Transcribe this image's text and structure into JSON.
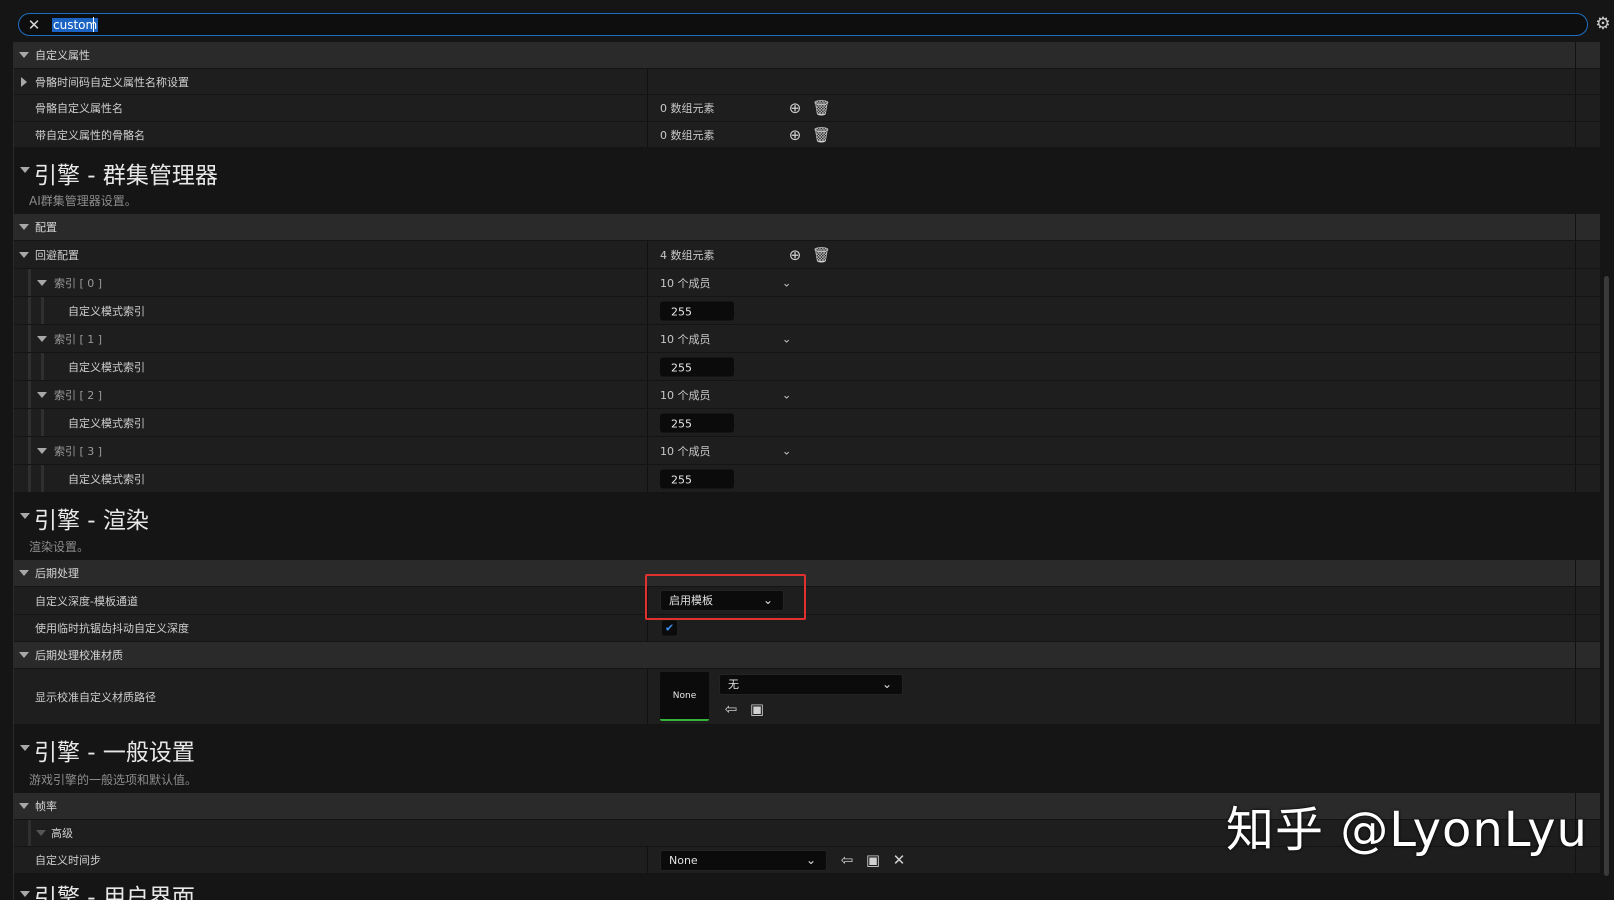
{
  "search": {
    "value": "custom"
  },
  "sections": {
    "custom_attrs": {
      "category": "自定义属性",
      "rows": [
        {
          "label": "骨骼时间码自定义属性名称设置"
        },
        {
          "label": "骨骼自定义属性名",
          "value": "0 数组元素"
        },
        {
          "label": "带自定义属性的骨骼名",
          "value": "0 数组元素"
        }
      ]
    },
    "crowd": {
      "title": "引擎 - 群集管理器",
      "subtitle": "AI群集管理器设置。",
      "category": "配置",
      "avoidance": {
        "label": "回避配置",
        "value": "4 数组元素"
      },
      "indices": [
        {
          "label": "索引 [ 0 ]",
          "members": "10 个成员",
          "child_label": "自定义模式索引",
          "child_value": "255"
        },
        {
          "label": "索引 [ 1 ]",
          "members": "10 个成员",
          "child_label": "自定义模式索引",
          "child_value": "255"
        },
        {
          "label": "索引 [ 2 ]",
          "members": "10 个成员",
          "child_label": "自定义模式索引",
          "child_value": "255"
        },
        {
          "label": "索引 [ 3 ]",
          "members": "10 个成员",
          "child_label": "自定义模式索引",
          "child_value": "255"
        }
      ]
    },
    "render": {
      "title": "引擎 - 渲染",
      "subtitle": "渲染设置。",
      "category": "后期处理",
      "stencil": {
        "label": "自定义深度-模板通道",
        "value": "启用模板"
      },
      "taa": {
        "label": "使用临时抗锯齿抖动自定义深度",
        "checked": true
      },
      "calib_category": "后期处理校准材质",
      "calib": {
        "label": "显示校准自定义材质路径",
        "thumb": "None",
        "value": "无"
      }
    },
    "general": {
      "title": "引擎 - 一般设置",
      "subtitle": "游戏引擎的一般选项和默认值。",
      "category": "帧率",
      "advanced": "高级",
      "timestep": {
        "label": "自定义时间步",
        "value": "None"
      }
    },
    "ui": {
      "title": "引擎 - 用户界面"
    }
  },
  "watermark": "知乎 @LyonLyu",
  "colors": {
    "accent": "#1c64c4",
    "highlight": "#e03030",
    "check": "#3d8eea",
    "thumb_underline": "#34b334"
  }
}
